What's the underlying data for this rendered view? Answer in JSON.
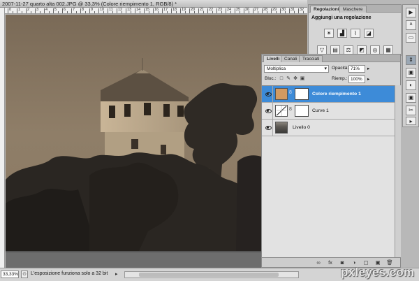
{
  "document": {
    "title": "2007-11-27 quarto alta 002.JPG @ 33,3% (Colore riempimento 1, RGB/8) *",
    "ruler_labels": [
      "0",
      "1",
      "2",
      "3",
      "4",
      "5",
      "6",
      "7",
      "8",
      "9",
      "10",
      "11",
      "12",
      "13",
      "14",
      "15",
      "16",
      "17",
      "18",
      "19",
      "20",
      "21",
      "22",
      "23",
      "24",
      "25",
      "26",
      "27",
      "28",
      "29",
      "30",
      "31",
      "32"
    ]
  },
  "statusbar": {
    "zoom": "33,33%",
    "message": "L'esposizione funziona solo a 32 bit",
    "arrow": "▸"
  },
  "adjustments": {
    "tabs": [
      "Regolazioni",
      "Maschere"
    ],
    "heading": "Aggiungi una regolazione",
    "row1_icons": [
      "☀",
      "▟",
      "⌇",
      "◪"
    ],
    "row2_icons": [
      "▽",
      "▤",
      "⚖",
      "◩",
      "◎",
      "▦"
    ]
  },
  "tools": {
    "icons": [
      "▶",
      "ᴬ",
      "▭",
      "⇕",
      "▣",
      "◐",
      "▣",
      "✂",
      "¶",
      "▸"
    ]
  },
  "layers": {
    "tabs": [
      "Livelli",
      "Canali",
      "Tracciati"
    ],
    "blend_mode": "Moltiplica",
    "opacity_label": "Opacità:",
    "opacity_value": "71%",
    "lock_label": "Bloc.:",
    "fill_label": "Riemp.:",
    "fill_value": "100%",
    "items": [
      {
        "name": "Colore riempimento 1",
        "selected": true
      },
      {
        "name": "Curve 1",
        "selected": false
      },
      {
        "name": "Livello 0",
        "selected": false
      }
    ],
    "footer_icons": [
      "∞",
      "fx",
      "◙",
      "◑",
      "▢",
      "▣",
      "🗑"
    ]
  },
  "watermark": "pxleyes.com",
  "colors": {
    "selection": "#3d8bd8",
    "fill_swatch": "#d39a61",
    "canvas_sepia": "#8b7a64"
  }
}
